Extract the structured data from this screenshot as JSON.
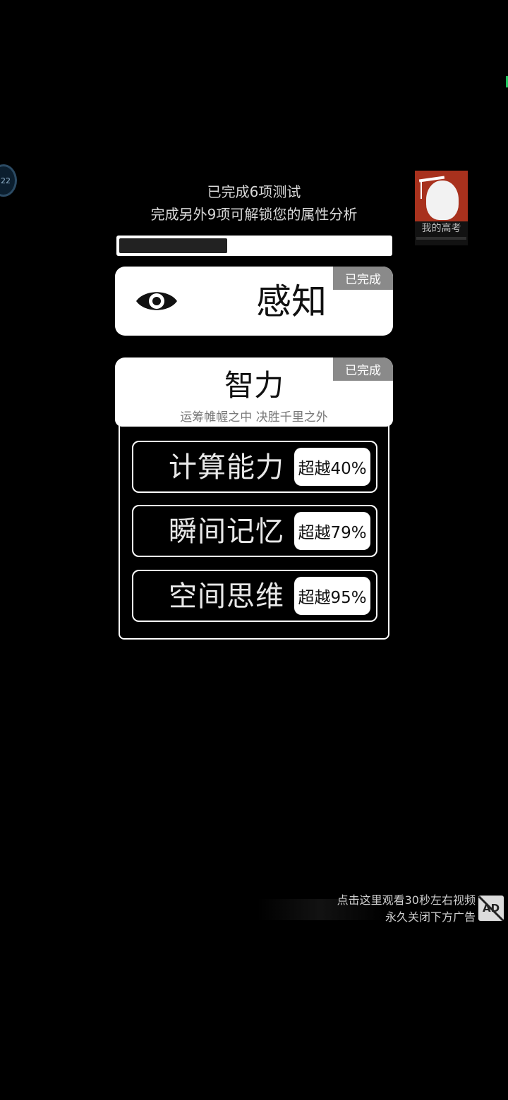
{
  "header": {
    "completed_text": "已完成6项测试",
    "unlock_text": "完成另外9项可解锁您的属性分析"
  },
  "progress": {
    "fraction": 0.4
  },
  "float_badge": {
    "label": "22"
  },
  "ad_thumb": {
    "title": "我的高考"
  },
  "cards": {
    "perception": {
      "title": "感知",
      "tag": "已完成",
      "icon": "eye-icon"
    },
    "intelligence": {
      "title": "智力",
      "subtitle": "运筹帷幄之中 决胜千里之外",
      "tag": "已完成"
    }
  },
  "skills": [
    {
      "name": "计算能力",
      "score": "超越40%"
    },
    {
      "name": "瞬间记忆",
      "score": "超越79%"
    },
    {
      "name": "空间思维",
      "score": "超越95%"
    }
  ],
  "ad_notice": {
    "line1": "点击这里观看30秒左右视频",
    "line2": "永久关闭下方广告",
    "icon_label": "AD"
  },
  "colors": {
    "background": "#000000",
    "card": "#ffffff",
    "tag": "#8a8a8a",
    "ad_thumb": "#a8311d",
    "edge_marker": "#22c55e"
  }
}
